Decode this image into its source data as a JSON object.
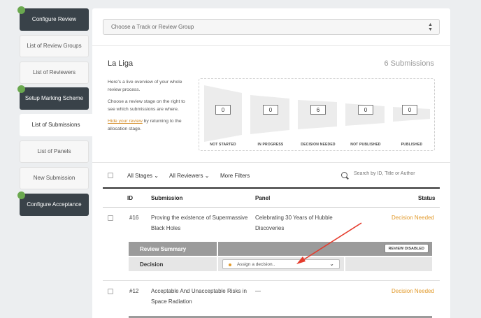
{
  "sidebar": {
    "items": [
      {
        "label": "Configure Review"
      },
      {
        "label": "List of Review Groups"
      },
      {
        "label": "List of Reviewers"
      },
      {
        "label": "Setup Marking Scheme"
      },
      {
        "label": "List of Submissions"
      },
      {
        "label": "List of Panels"
      },
      {
        "label": "New Submission"
      },
      {
        "label": "Configure Acceptance"
      }
    ]
  },
  "track_select": {
    "placeholder": "Choose a Track or Review Group"
  },
  "overview": {
    "title": "La Liga",
    "submissions_count": "6 Submissions",
    "intro_1": "Here's a live overview of your whole review process.",
    "intro_2": "Choose a review stage on the right to see which submissions are where.",
    "intro_link": "Hide your review",
    "intro_3": " by returning to the allocation stage."
  },
  "stages": [
    {
      "label": "NOT STARTED",
      "count": "0"
    },
    {
      "label": "IN PROGRESS",
      "count": "0"
    },
    {
      "label": "DECISION NEEDED",
      "count": "6"
    },
    {
      "label": "NOT PUBLISHED",
      "count": "0"
    },
    {
      "label": "PUBLISHED",
      "count": "0"
    }
  ],
  "filters": {
    "stages": "All Stages",
    "reviewers": "All Reviewers",
    "more": "More Filters",
    "search_placeholder": "Search by ID, Title or Author"
  },
  "table": {
    "headers": {
      "id": "ID",
      "submission": "Submission",
      "panel": "Panel",
      "status": "Status"
    },
    "rows": [
      {
        "id": "#16",
        "submission": "Proving the existence of Supermassive Black Holes",
        "panel": "Celebrating 30 Years of Hubble Discoveries",
        "status": "Decision Needed"
      },
      {
        "id": "#12",
        "submission": "Acceptable And Unacceptable Risks in Space Radiation",
        "panel": "—",
        "status": "Decision Needed"
      }
    ]
  },
  "review_panel": {
    "summary_label": "Review Summary",
    "review_disabled_button": "REVIEW DISABLED",
    "decision_label": "Decision",
    "decision_placeholder": "Assign a decision.."
  },
  "colors": {
    "accent": "#e29a2b",
    "sidebar_dark": "#394249",
    "complete_dot": "#6aa84f",
    "arrow": "#e53b2c"
  }
}
